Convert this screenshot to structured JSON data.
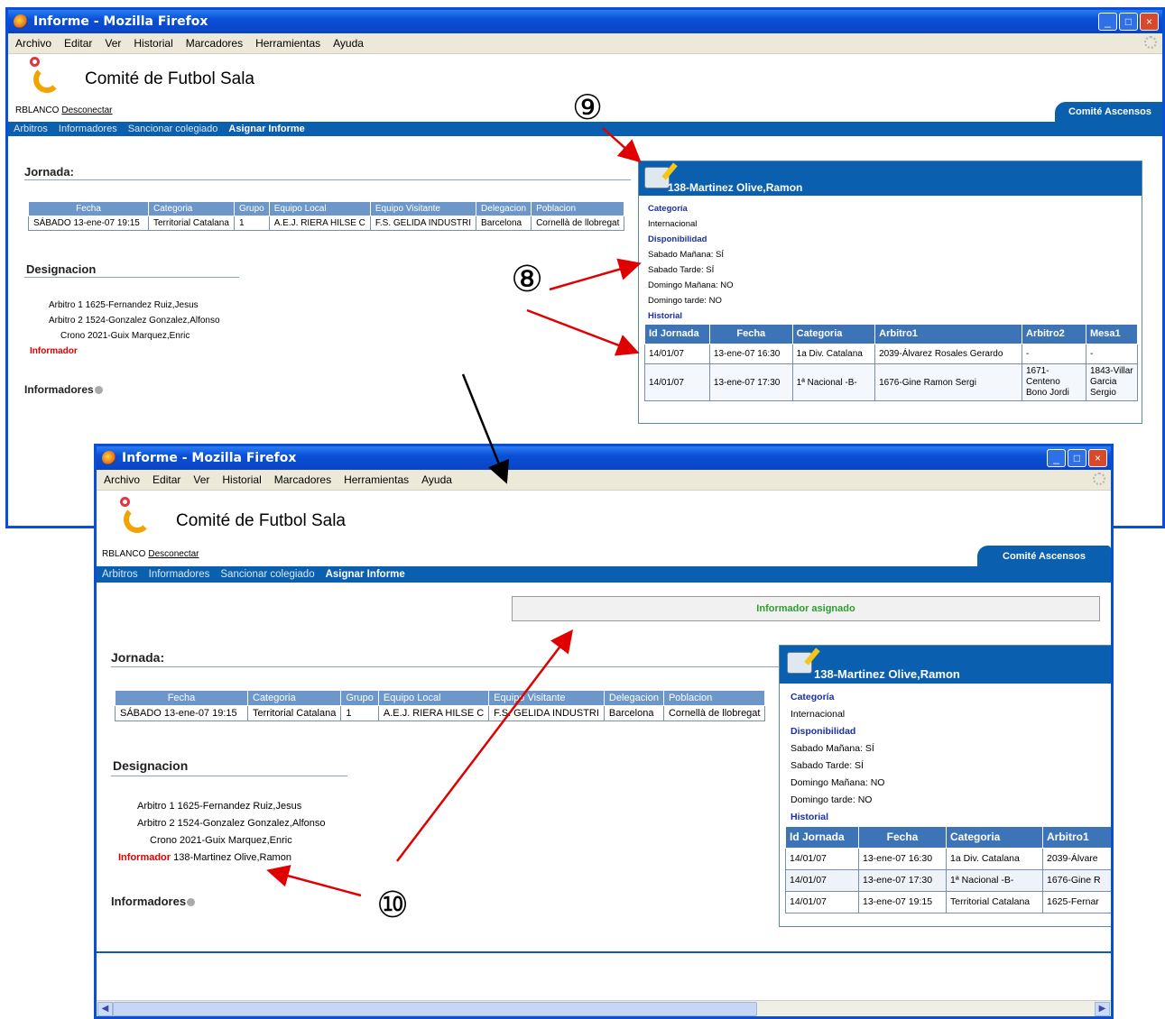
{
  "browser": {
    "title": "Informe - Mozilla Firefox",
    "menu": [
      "Archivo",
      "Editar",
      "Ver",
      "Historial",
      "Marcadores",
      "Herramientas",
      "Ayuda"
    ]
  },
  "site": {
    "title": "Comité de Futbol Sala",
    "user": "RBLANCO",
    "logout": "Desconectar",
    "tab": "Comité Ascensos",
    "nav": [
      "Arbitros",
      "Informadores",
      "Sancionar colegiado",
      "Asignar Informe"
    ]
  },
  "jornada": {
    "heading": "Jornada:",
    "headers": [
      "Fecha",
      "Categoria",
      "Grupo",
      "Equipo Local",
      "Equipo Visitante",
      "Delegacion",
      "Poblacion"
    ],
    "row": [
      "SÁBADO 13-ene-07 19:15",
      "Territorial Catalana",
      "1",
      "A.E.J. RIERA HILSE C",
      "F.S. GELIDA INDUSTRI",
      "Barcelona",
      "Cornellà de llobregat"
    ]
  },
  "designacion": {
    "heading": "Designacion",
    "arbitro1": "Arbitro 1 1625-Fernandez Ruiz,Jesus",
    "arbitro2": "Arbitro 2 1524-Gonzalez Gonzalez,Alfonso",
    "crono": "Crono 2021-Guix Marquez,Enric",
    "informador_label": "Informador",
    "informador_value": "138-Martinez Olive,Ramon"
  },
  "informadores": "Informadores",
  "message": "Informador asignado",
  "panel": {
    "title": "138-Martinez Olive,Ramon",
    "categoria_label": "Categoría",
    "categoria": "Internacional",
    "disponibilidad_label": "Disponibilidad",
    "disp": [
      "Sabado Mañana: SÍ",
      "Sabado Tarde: SÍ",
      "Domingo Mañana: NO",
      "Domingo tarde: NO"
    ],
    "historial_label": "Historial",
    "top_headers": [
      "Id Jornada",
      "Fecha",
      "Categoria",
      "Arbitro1",
      "Arbitro2",
      "Mesa1"
    ],
    "top_rows": [
      [
        "14/01/07",
        "13-ene-07 16:30",
        "1a Div. Catalana",
        "2039-Álvarez Rosales Gerardo",
        "-",
        "-"
      ],
      [
        "14/01/07",
        "13-ene-07 17:30",
        "1ª Nacional -B-",
        "1676-Gine Ramon Sergi",
        "1671-Centeno Bono Jordi",
        "1843-Villar Garcia Sergio"
      ]
    ],
    "bottom_headers": [
      "Id Jornada",
      "Fecha",
      "Categoria",
      "Arbitro1"
    ],
    "bottom_rows": [
      [
        "14/01/07",
        "13-ene-07 16:30",
        "1a Div. Catalana",
        "2039-Álvare"
      ],
      [
        "14/01/07",
        "13-ene-07 17:30",
        "1ª Nacional -B-",
        "1676-Gine R"
      ],
      [
        "14/01/07",
        "13-ene-07 19:15",
        "Territorial Catalana",
        "1625-Fernar"
      ]
    ]
  },
  "callouts": [
    "⑨",
    "⑧",
    "⑩"
  ]
}
